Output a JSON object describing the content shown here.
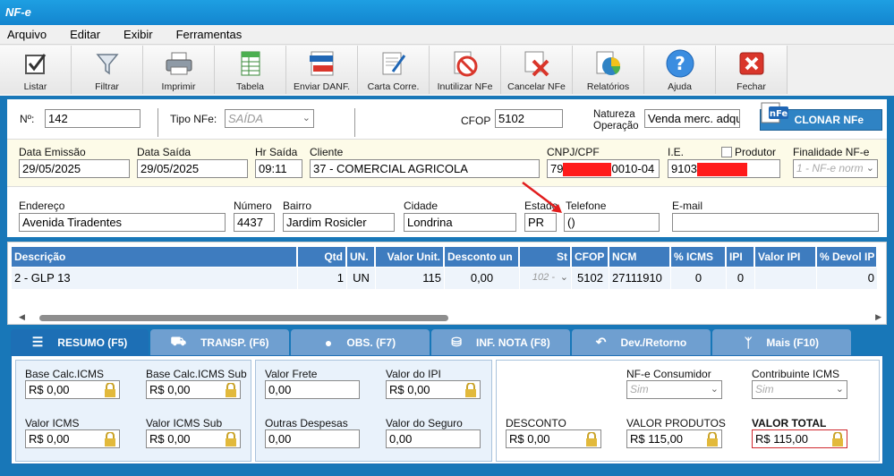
{
  "app": {
    "title": "NF-e"
  },
  "menu": [
    "Arquivo",
    "Editar",
    "Exibir",
    "Ferramentas"
  ],
  "toolbar": [
    {
      "label": "Listar",
      "icon": "checkbox-icon"
    },
    {
      "label": "Filtrar",
      "icon": "funnel-icon"
    },
    {
      "label": "Imprimir",
      "icon": "printer-icon"
    },
    {
      "label": "Tabela",
      "icon": "spreadsheet-icon"
    },
    {
      "label": "Enviar DANF.",
      "icon": "xml-pdf-icon"
    },
    {
      "label": "Carta Corre.",
      "icon": "document-pen-icon"
    },
    {
      "label": "Inutilizar NFe",
      "icon": "no-entry-icon"
    },
    {
      "label": "Cancelar NFe",
      "icon": "cancel-doc-icon"
    },
    {
      "label": "Relatórios",
      "icon": "pie-chart-icon"
    },
    {
      "label": "Ajuda",
      "icon": "help-icon"
    },
    {
      "label": "Fechar",
      "icon": "close-icon"
    }
  ],
  "header": {
    "numero_label": "Nº:",
    "numero": "142",
    "tipo_label": "Tipo NFe:",
    "tipo": "SAÍDA",
    "cfop_label": "CFOP",
    "cfop": "5102",
    "natureza_label1": "Natureza",
    "natureza_label2": "Operação",
    "natureza": "Venda merc. adqu",
    "clone_label": "CLONAR NFe"
  },
  "row2": {
    "data_emissao_label": "Data Emissão",
    "data_emissao": "29/05/2025",
    "data_saida_label": "Data Saída",
    "data_saida": "29/05/2025",
    "hr_saida_label": "Hr Saída",
    "hr_saida": "09:11",
    "cliente_label": "Cliente",
    "cliente": "37 - COMERCIAL AGRICOLA",
    "cnpj_label": "CNPJ/CPF",
    "cnpj_prefix": "79",
    "cnpj_suffix": "0010-04",
    "ie_label": "I.E.",
    "ie_prefix": "9103",
    "produtor_label": "Produtor",
    "finalidade_label": "Finalidade NF-e",
    "finalidade": "1 - NF-e norm"
  },
  "row3": {
    "endereco_label": "Endereço",
    "endereco": "Avenida Tiradentes",
    "numero_label": "Número",
    "numero": "4437",
    "bairro_label": "Bairro",
    "bairro": "Jardim Rosicler",
    "cidade_label": "Cidade",
    "cidade": "Londrina",
    "estado_label": "Estado",
    "estado": "PR",
    "telefone_label": "Telefone",
    "telefone": "()",
    "email_label": "E-mail",
    "email": ""
  },
  "items": {
    "columns": [
      "Descrição",
      "Qtd",
      "UN.",
      "Valor Unit.",
      "Desconto un",
      "St",
      "CFOP",
      "NCM",
      "% ICMS",
      "IPI",
      "Valor IPI",
      "% Devol IP"
    ],
    "rows": [
      {
        "descricao": "2 - GLP 13",
        "qtd": "1",
        "un": "UN",
        "valor_unit": "115",
        "desconto": "0,00",
        "st": "102 -",
        "cfop": "5102",
        "ncm": "27111910",
        "icms": "0",
        "ipi": "0",
        "valor_ipi": "",
        "devol": "0"
      }
    ]
  },
  "tabs": [
    {
      "label": "RESUMO (F5)",
      "icon": "list-icon"
    },
    {
      "label": "TRANSP. (F6)",
      "icon": "truck-icon"
    },
    {
      "label": "OBS. (F7)",
      "icon": "chat-icon"
    },
    {
      "label": "INF. NOTA (F8)",
      "icon": "database-icon"
    },
    {
      "label": "Dev./Retorno",
      "icon": "return-arrow-icon"
    },
    {
      "label": "Mais (F10)",
      "icon": "fork-icon"
    }
  ],
  "resumo": {
    "bc_icms_label": "Base Calc.ICMS",
    "bc_icms": "R$ 0,00",
    "bc_icms_sub_label": "Base Calc.ICMS Sub",
    "bc_icms_sub": "R$ 0,00",
    "valor_icms_label": "Valor ICMS",
    "valor_icms": "R$ 0,00",
    "valor_icms_sub_label": "Valor ICMS Sub",
    "valor_icms_sub": "R$ 0,00",
    "valor_frete_label": "Valor Frete",
    "valor_frete": "0,00",
    "valor_ipi_label": "Valor do IPI",
    "valor_ipi": "R$ 0,00",
    "outras_label": "Outras Despesas",
    "outras": "0,00",
    "seguro_label": "Valor do Seguro",
    "seguro": "0,00",
    "consumidor_label": "NF-e Consumidor",
    "consumidor": "Sim",
    "contribuinte_label": "Contribuinte ICMS",
    "contribuinte": "Sim",
    "desconto_label": "DESCONTO",
    "desconto": "R$ 0,00",
    "valor_produtos_label": "VALOR PRODUTOS",
    "valor_produtos": "R$ 115,00",
    "valor_total_label": "VALOR TOTAL",
    "valor_total": "R$ 115,00"
  }
}
